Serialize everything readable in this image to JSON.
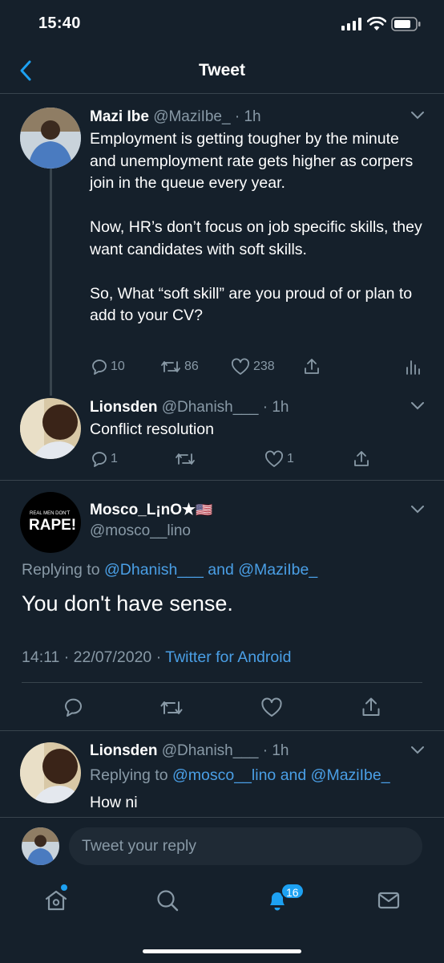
{
  "status": {
    "time": "15:40"
  },
  "header": {
    "title": "Tweet"
  },
  "tweet1": {
    "name": "Mazi Ibe",
    "handle": "@MaziIbe_",
    "time": "1h",
    "text": "Employment is getting tougher by the minute and unemployment rate gets higher as corpers join in the queue every year.\n\nNow, HR’s don’t focus on job specific skills, they want candidates with soft skills.\n\nSo, What “soft skill” are you proud of or plan to add to your CV?",
    "replies": "10",
    "retweets": "86",
    "likes": "238"
  },
  "tweet2": {
    "name": "Lionsden",
    "handle": "@Dhanish___",
    "time": "1h",
    "text": "Conflict resolution",
    "replies": "1",
    "likes": "1"
  },
  "main_tweet": {
    "name": "Mosco_L¡nO★",
    "flag": "🇺🇸",
    "handle": "@mosco__lino",
    "replying_prefix": "Replying to",
    "reply_to_1": "@Dhanish___",
    "reply_and": "and",
    "reply_to_2": "@MaziIbe_",
    "text": "You don't have sense.",
    "timestamp": "14:11 · 22/07/2020 ·",
    "client": "Twitter for Android",
    "avatar_text_small": "REAL MEN DON'T",
    "avatar_text_big": "RAPE!"
  },
  "tweet4": {
    "name": "Lionsden",
    "handle": "@Dhanish___",
    "time": "1h",
    "replying_prefix": "Replying to",
    "reply_to_1": "@mosco__lino",
    "reply_and": "and",
    "reply_to_2": "@MaziIbe_",
    "text": "How ni"
  },
  "reply_input": {
    "placeholder": "Tweet your reply"
  },
  "tabbar": {
    "notifications_badge": "16"
  },
  "colors": {
    "background": "#15202b",
    "accent": "#1da1f2",
    "muted": "#8899a6",
    "divider": "#38444d"
  },
  "icons": [
    "back-chevron-icon",
    "signal-icon",
    "wifi-icon",
    "battery-icon",
    "chevron-down-icon",
    "reply-icon",
    "retweet-icon",
    "like-icon",
    "share-icon",
    "analytics-icon",
    "home-icon",
    "search-icon",
    "notifications-icon",
    "messages-icon"
  ]
}
